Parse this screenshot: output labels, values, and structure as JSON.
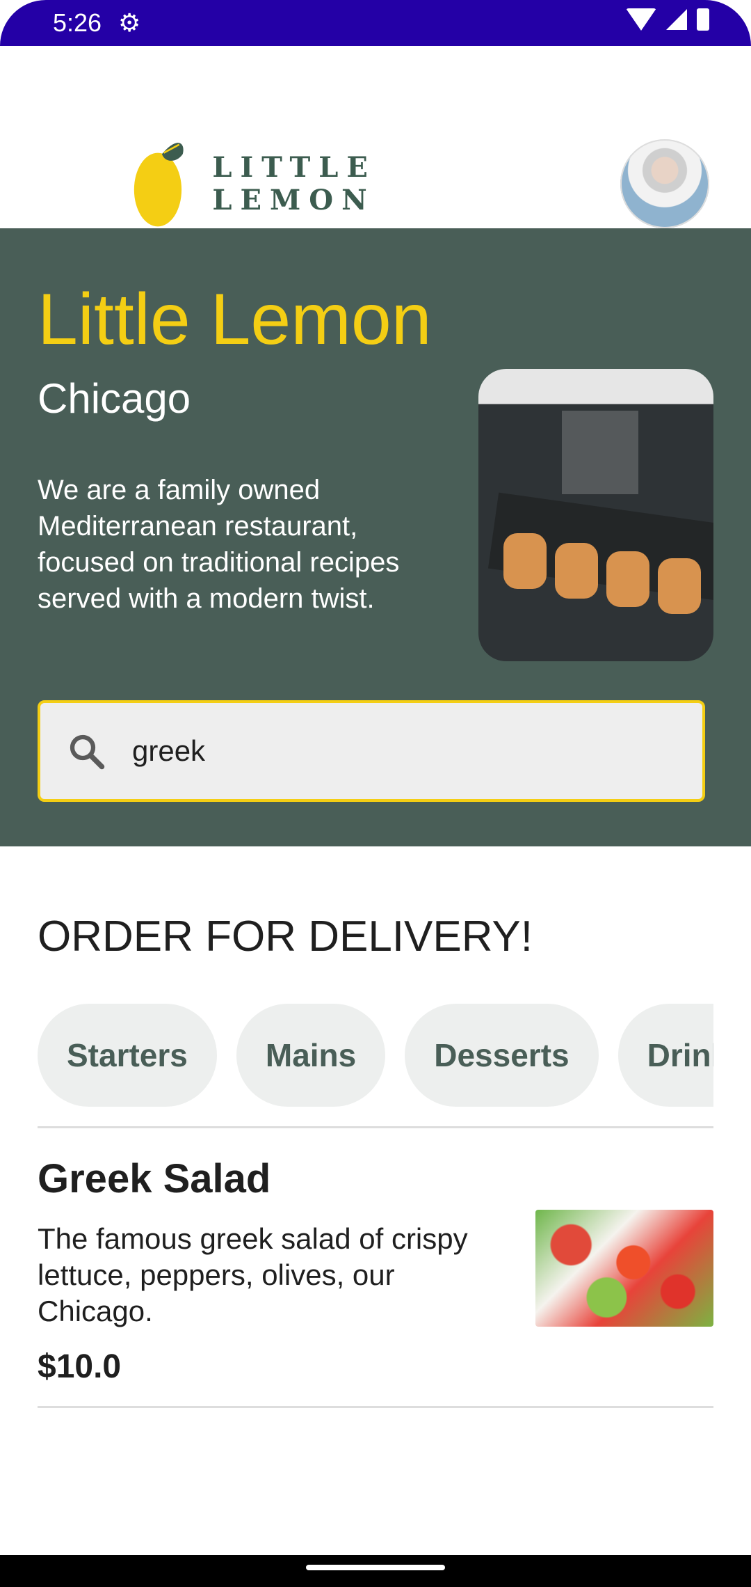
{
  "status_bar": {
    "time": "5:26",
    "gear": "⚙"
  },
  "header": {
    "logo_text": "LITTLE LEMON"
  },
  "hero": {
    "title": "Little Lemon",
    "city": "Chicago",
    "description": "We are a family owned Mediterranean restaurant, focused on traditional recipes served with a modern twist."
  },
  "search": {
    "value": "greek"
  },
  "order": {
    "title": "ORDER FOR DELIVERY!",
    "categories": [
      "Starters",
      "Mains",
      "Desserts",
      "Drinks"
    ]
  },
  "menu_item": {
    "title": "Greek Salad",
    "description": "The famous greek salad of crispy lettuce, peppers, olives, our Chicago.",
    "price": "$10.0"
  },
  "colors": {
    "status_bar": "#2400A6",
    "hero_bg": "#495e57",
    "accent_yellow": "#F4CE14",
    "chip_bg": "#edefee"
  }
}
